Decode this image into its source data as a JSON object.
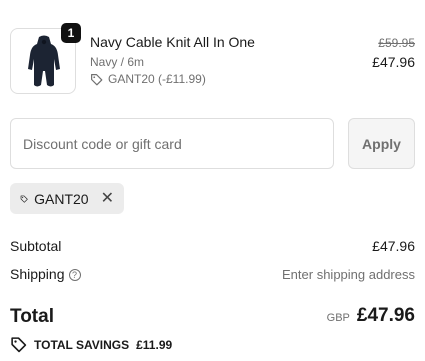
{
  "line_item": {
    "quantity": "1",
    "name": "Navy Cable Knit All In One",
    "variant": "Navy / 6m",
    "discount_label": "GANT20 (-£11.99)",
    "original_price": "£59.95",
    "price": "£47.96",
    "product_color": "#1c2433"
  },
  "discount_form": {
    "placeholder": "Discount code or gift card",
    "apply_label": "Apply"
  },
  "applied_code": {
    "code": "GANT20"
  },
  "summary": {
    "subtotal_label": "Subtotal",
    "subtotal_value": "£47.96",
    "shipping_label": "Shipping",
    "shipping_value": "Enter shipping address",
    "total_label": "Total",
    "currency": "GBP",
    "total_value": "£47.96",
    "savings_label": "TOTAL SAVINGS",
    "savings_value": "£11.99"
  }
}
